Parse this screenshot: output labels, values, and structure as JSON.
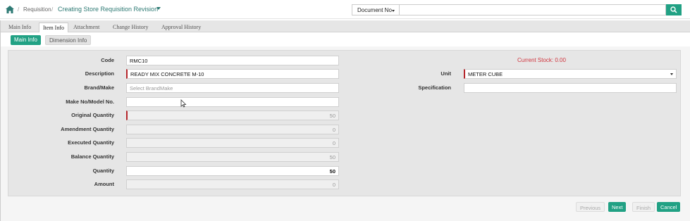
{
  "header": {
    "breadcrumb_parent": "Requisition",
    "title": "Creating Store Requisition Revision",
    "search_type": "Document No",
    "search_value": ""
  },
  "tabs": [
    {
      "label": "Main Info",
      "active": false
    },
    {
      "label": "Item Info",
      "active": true
    },
    {
      "label": "Attachment",
      "active": false
    },
    {
      "label": "Change History",
      "active": false
    },
    {
      "label": "Approval History",
      "active": false
    }
  ],
  "subtabs": [
    {
      "label": "Main Info",
      "active": true
    },
    {
      "label": "Dimension Info",
      "active": false
    }
  ],
  "form": {
    "code_label": "Code",
    "code_value": "RMC10",
    "description_label": "Description",
    "description_value": "READY MIX CONCRETE M-10",
    "brand_label": "Brand/Make",
    "brand_placeholder": "Select BrandMake",
    "make_label": "Make No/Model No.",
    "make_value": "",
    "original_qty_label": "Original Quantity",
    "original_qty_value": "50",
    "amendment_qty_label": "Amendment Quantity",
    "amendment_qty_value": "0",
    "executed_qty_label": "Executed Quantity",
    "executed_qty_value": "0",
    "balance_qty_label": "Balance Quantity",
    "balance_qty_value": "50",
    "quantity_label": "Quantity",
    "quantity_value": "50",
    "amount_label": "Amount",
    "amount_value": "0",
    "current_stock": "Current Stock: 0.00",
    "unit_label": "Unit",
    "unit_value": "METER CUBE",
    "specification_label": "Specification",
    "specification_value": ""
  },
  "footer": {
    "previous": "Previous",
    "next": "Next",
    "finish": "Finish",
    "cancel": "Cancel"
  },
  "colors": {
    "accent": "#21a184",
    "title": "#2e7a74",
    "required": "#b5262b",
    "stock": "#d0353e"
  },
  "icons": [
    "home-icon",
    "search-icon",
    "cursor-pointer-icon"
  ]
}
